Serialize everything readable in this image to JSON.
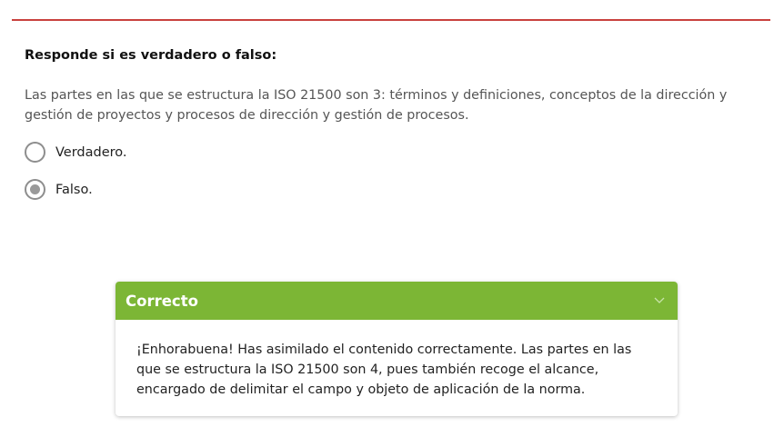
{
  "question": {
    "title": "Responde si es verdadero o falso:",
    "text": "Las partes en las que se estructura la ISO 21500 son 3: términos y definiciones, conceptos de la dirección y gestión de proyectos y procesos de dirección y gestión de procesos.",
    "options": [
      {
        "label": "Verdadero.",
        "selected": false
      },
      {
        "label": "Falso.",
        "selected": true
      }
    ]
  },
  "feedback": {
    "title": "Correcto",
    "toggle_icon": "chevron-down-icon",
    "body": "¡Enhorabuena! Has asimilado el contenido correctamente. Las partes en las que se estructura la ISO 21500 son 4, pues también recoge el alcance, encargado de delimitar el campo y objeto de aplicación de la norma."
  },
  "colors": {
    "accent_rule": "#c9413e",
    "feedback_header": "#7cb635"
  }
}
